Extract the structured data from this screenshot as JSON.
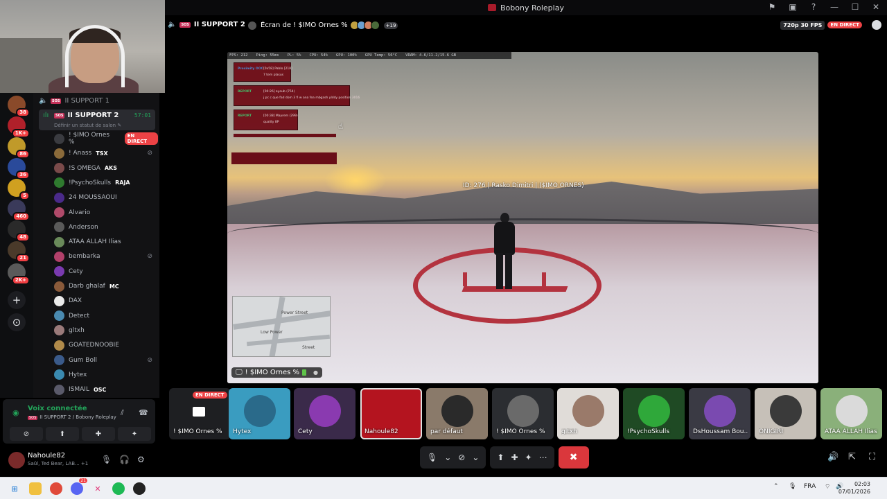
{
  "window": {
    "title": "Bobony Roleplay"
  },
  "stream_header": {
    "channel": "II SUPPORT 2",
    "screen_title": "Écran de ! $IMO Ornes %",
    "extra_viewers": "+19",
    "quality": "720p 30 FPS",
    "live": "EN DIRECT"
  },
  "rail": {
    "badges": [
      "38",
      "1K+",
      "86",
      "36",
      "5",
      "460",
      "48",
      "21",
      "2K+"
    ]
  },
  "channels": {
    "support1": "II SUPPORT 1",
    "support2": "II SUPPORT 2",
    "timer": "57:01",
    "status_placeholder": "Définir un statut de salon",
    "live_badge": "EN DIRECT",
    "users": [
      {
        "name": "! $IMO Ornes %",
        "extra": "",
        "color": "#3a3b40"
      },
      {
        "name": "! Anass",
        "extra": "TSX",
        "color": "#8a6a3a"
      },
      {
        "name": "!S OMEGA",
        "extra": "AKS",
        "color": "#7a4a4a"
      },
      {
        "name": "!PsychoSkulls",
        "extra": "RAJA",
        "color": "#2f7a2f"
      },
      {
        "name": "24 MOUSSAOUI",
        "extra": "",
        "color": "#4a2a8a"
      },
      {
        "name": "Alvario",
        "extra": "",
        "color": "#b04a6a"
      },
      {
        "name": "Anderson",
        "extra": "",
        "color": "#5a5a5a"
      },
      {
        "name": "ATAA ALLAH Ilias",
        "extra": "",
        "color": "#6a8a5a"
      },
      {
        "name": "bembarka",
        "extra": "",
        "color": "#b2406a"
      },
      {
        "name": "Cety",
        "extra": "",
        "color": "#7a3ab0"
      },
      {
        "name": "Darb ghalaf",
        "extra": "MC",
        "color": "#8a5a3a"
      },
      {
        "name": "DAX",
        "extra": "",
        "color": "#eaeaea"
      },
      {
        "name": "Detect",
        "extra": "",
        "color": "#4a8ab0"
      },
      {
        "name": "gltxh",
        "extra": "",
        "color": "#9a7a7a"
      },
      {
        "name": "GOATEDNOOBIE",
        "extra": "",
        "color": "#b08a4a"
      },
      {
        "name": "Gum Boll",
        "extra": "",
        "color": "#3a5a8a"
      },
      {
        "name": "Hytex",
        "extra": "",
        "color": "#3a8ab0"
      },
      {
        "name": "ISMAIL",
        "extra": "OSC",
        "color": "#5a5a6a"
      }
    ]
  },
  "voice_panel": {
    "title": "Voix connectée",
    "subtitle": "II SUPPORT 2 / Bobony Roleplay"
  },
  "user": {
    "name": "Nahoule82",
    "status": "Saûl, Ted Bear, LAB... +1"
  },
  "game": {
    "perf": [
      "FPS: 212",
      "Ping: 55ms",
      "PL: 5%",
      "CPU: 54%",
      "GPU: 100%",
      "GPU Temp: 56°C",
      "VRAM: 4.6/11.2/15.6 GB"
    ],
    "nameplate": "ID: 276 | Rasko Dimitri | ($IMO ORNES)",
    "reports": [
      {
        "tag": "Proximity OOC",
        "line1": "[0x58] Pablo [218]",
        "line2": "7 tem plasus"
      },
      {
        "tag": "REPORT",
        "line1": "[00:26] ayoub (754)",
        "line2": "j pc c que fad dom 3 fi w ana fea mbgash ylddy position 3016"
      },
      {
        "tag": "REPORT",
        "line1": "[00:38] Mayrem (299)",
        "line2": "quality 8P"
      }
    ],
    "map_labels": [
      "Power Street",
      "Low Power",
      "Street"
    ],
    "stream_label": "! $IMO Ornes %"
  },
  "participants": [
    {
      "name": "! $IMO Ornes %",
      "self": true,
      "live": "EN DIRECT",
      "bg": "#1e1f22",
      "av": ""
    },
    {
      "name": "Hytex",
      "bg": "#3a9cc0",
      "av": "#2a6a8a"
    },
    {
      "name": "Cety",
      "bg": "#3a2a4a",
      "av": "#8a3ab0"
    },
    {
      "name": "Nahoule82",
      "bg": "#b4141f",
      "av": "",
      "selected": true
    },
    {
      "name": "par défaut",
      "bg": "#8a7a6a",
      "av": "#2a2a2a"
    },
    {
      "name": "! $IMO Ornes %",
      "bg": "#2b2d31",
      "av": "#6a6a6a"
    },
    {
      "name": "gltxh",
      "bg": "#e0dcd8",
      "av": "#9a7a6a"
    },
    {
      "name": "!PsychoSkulls",
      "bg": "#1f4a24",
      "av": "#2fa83a"
    },
    {
      "name": "DsHoussam Bou...",
      "bg": "#3a3a44",
      "av": "#7a4ab0"
    },
    {
      "name": "ONIGIRI",
      "bg": "#c6c0b8",
      "av": "#3a3a3a"
    },
    {
      "name": "ATAA ALLAH Ilias",
      "bg": "#8ab07a",
      "av": "#dadada"
    }
  ],
  "taskbar": {
    "lang": "FRA",
    "time": "02:03",
    "date": "07/01/2026",
    "discord_badge": "21"
  }
}
